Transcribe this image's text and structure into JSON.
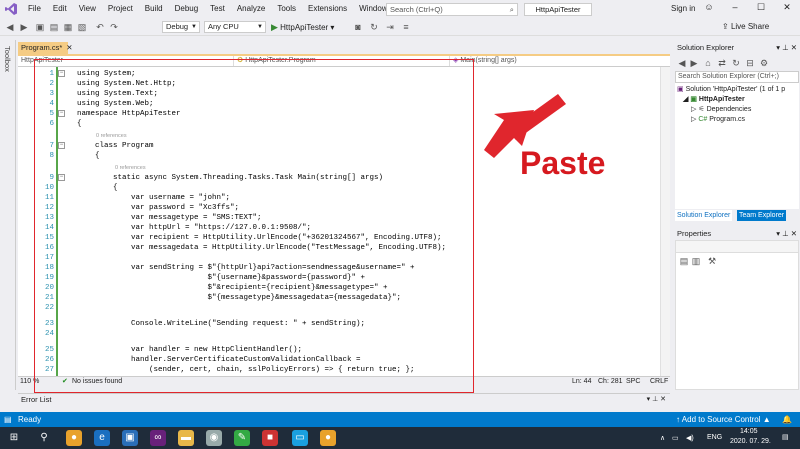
{
  "menubar": {
    "items": [
      "File",
      "Edit",
      "View",
      "Project",
      "Build",
      "Debug",
      "Test",
      "Analyze",
      "Tools",
      "Extensions",
      "Window",
      "Help"
    ],
    "search_placeholder": "Search (Ctrl+Q)",
    "app_name": "HttpApiTester",
    "sign_in": "Sign in"
  },
  "toolbar": {
    "config": "Debug",
    "platform": "Any CPU",
    "run_label": "HttpApiTester",
    "live_share": "Live Share"
  },
  "toolbox_label": "Toolbox",
  "doc_tab": "Program.cs*",
  "navbar": {
    "project": "HttpApiTester",
    "class": "HttpApiTester.Program",
    "member": "Main(string[] args)"
  },
  "code": {
    "lines": [
      {
        "n": "1",
        "t": "using System;"
      },
      {
        "n": "2",
        "t": "using System.Net.Http;"
      },
      {
        "n": "3",
        "t": "using System.Text;"
      },
      {
        "n": "4",
        "t": "using System.Web;"
      },
      {
        "n": "5",
        "t": "namespace HttpApiTester"
      },
      {
        "n": "6",
        "t": "{"
      },
      {
        "n": "7",
        "t": "    class Program"
      },
      {
        "n": "8",
        "t": "    {"
      },
      {
        "n": "9",
        "t": "        static async System.Threading.Tasks.Task Main(string[] args)"
      },
      {
        "n": "10",
        "t": "        {"
      },
      {
        "n": "11",
        "t": "            var username = \"john\";"
      },
      {
        "n": "12",
        "t": "            var password = \"Xc3ffs\";"
      },
      {
        "n": "13",
        "t": "            var messagetype = \"SMS:TEXT\";"
      },
      {
        "n": "14",
        "t": "            var httpUrl = \"https://127.0.0.1:9508/\";"
      },
      {
        "n": "15",
        "t": "            var recipient = HttpUtility.UrlEncode(\"+36201324567\", Encoding.UTF8);"
      },
      {
        "n": "16",
        "t": "            var messagedata = HttpUtility.UrlEncode(\"TestMessage\", Encoding.UTF8);"
      },
      {
        "n": "17",
        "t": ""
      },
      {
        "n": "18",
        "t": "            var sendString = $\"{httpUrl}api?action=sendmessage&username=\" +"
      },
      {
        "n": "19",
        "t": "                             $\"{username}&password={password}\" +"
      },
      {
        "n": "20",
        "t": "                             $\"&recipient={recipient}&messagetype=\" +"
      },
      {
        "n": "21",
        "t": "                             $\"{messagetype}&messagedata={messagedata}\";"
      },
      {
        "n": "22",
        "t": ""
      },
      {
        "n": "23",
        "t": "            Console.WriteLine(\"Sending request: \" + sendString);"
      },
      {
        "n": "24",
        "t": ""
      },
      {
        "n": "25",
        "t": "            var handler = new HttpClientHandler();"
      },
      {
        "n": "26",
        "t": "            handler.ServerCertificateCustomValidationCallback ="
      },
      {
        "n": "27",
        "t": "                (sender, cert, chain, sslPolicyErrors) => { return true; };"
      }
    ],
    "references": "0 references"
  },
  "editor_status": {
    "zoom": "110 %",
    "issues": "No issues found",
    "line": "Ln: 44",
    "col": "Ch: 281",
    "mode": "SPC",
    "eol": "CRLF"
  },
  "annotation": "Paste",
  "error_list": "Error List",
  "solution_explorer": {
    "title": "Solution Explorer",
    "search_placeholder": "Search Solution Explorer (Ctrl+;)",
    "solution": "Solution 'HttpApiTester' (1 of 1 p",
    "project": "HttpApiTester",
    "dependencies": "Dependencies",
    "file": "Program.cs",
    "tab1": "Solution Explorer",
    "tab2": "Team Explorer"
  },
  "properties_title": "Properties",
  "statusbar": {
    "ready": "Ready",
    "source_control": "Add to Source Control"
  },
  "tray": {
    "lang": "ENG",
    "time": "14:05",
    "date": "2020. 07. 29."
  }
}
